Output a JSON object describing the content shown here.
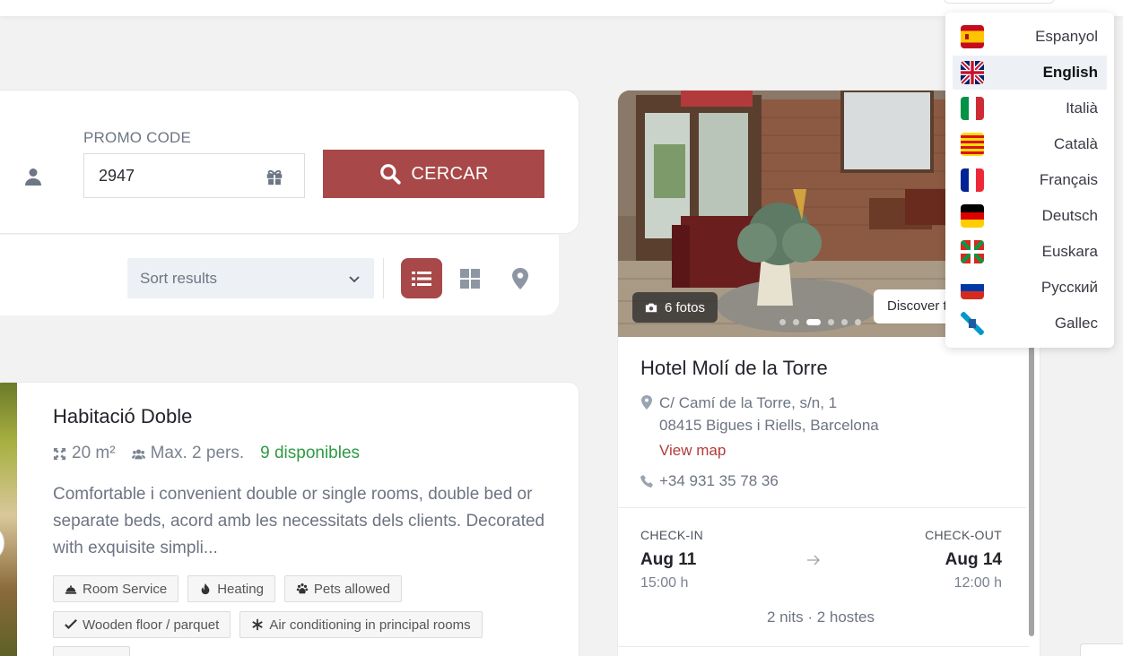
{
  "search": {
    "promo_label": "PROMO CODE",
    "promo_value": "2947",
    "search_button_label": "CERCAR",
    "search_button_color": "#a84848"
  },
  "sort": {
    "label": "Sort results",
    "views": [
      "list-view",
      "grid-view",
      "map-view"
    ],
    "active_view": "list-view"
  },
  "room": {
    "title": "Habitació Doble",
    "size": "20 m²",
    "capacity": "Max. 2 pers.",
    "availability": "9 disponibles",
    "description": "Comfortable i convenient double or single rooms, double bed or separate beds, acord amb les necessitats dels clients. Decorated with exquisite simpli...",
    "amenities_row1": [
      "Room Service",
      "Heating",
      "Pets allowed"
    ],
    "amenities_row2": [
      "Wooden floor / parquet",
      "Air conditioning in principal rooms"
    ]
  },
  "hotel": {
    "photos_label": "6 fotos",
    "discover_label": "Discover the hotel",
    "name": "Hotel Molí de la Torre",
    "address_line1": "C/ Camí de la Torre, s/n, 1",
    "address_line2": "08415 Bigues i Riells, Barcelona",
    "view_map": "View map",
    "phone": "+34 931 35 78 36",
    "checkin_label": "CHECK-IN",
    "checkin_date": "Aug 11",
    "checkin_time": "15:00 h",
    "checkout_label": "CHECK-OUT",
    "checkout_date": "Aug 14",
    "checkout_time": "12:00 h",
    "stay_summary": "2 nits · 2 hostes",
    "photo_count_dots": 6,
    "active_dot": 2
  },
  "languages": {
    "active": "English",
    "items": [
      {
        "label": "Espanyol",
        "flag": "spain-flag"
      },
      {
        "label": "English",
        "flag": "uk-flag"
      },
      {
        "label": "Italià",
        "flag": "italy-flag"
      },
      {
        "label": "Català",
        "flag": "catalonia-flag"
      },
      {
        "label": "Français",
        "flag": "france-flag"
      },
      {
        "label": "Deutsch",
        "flag": "germany-flag"
      },
      {
        "label": "Euskara",
        "flag": "basque-flag"
      },
      {
        "label": "Русский",
        "flag": "russia-flag"
      },
      {
        "label": "Gallec",
        "flag": "galicia-flag"
      }
    ]
  },
  "colors": {
    "accent": "#a84848",
    "link": "#b23b3b",
    "available": "#2e9a44"
  }
}
